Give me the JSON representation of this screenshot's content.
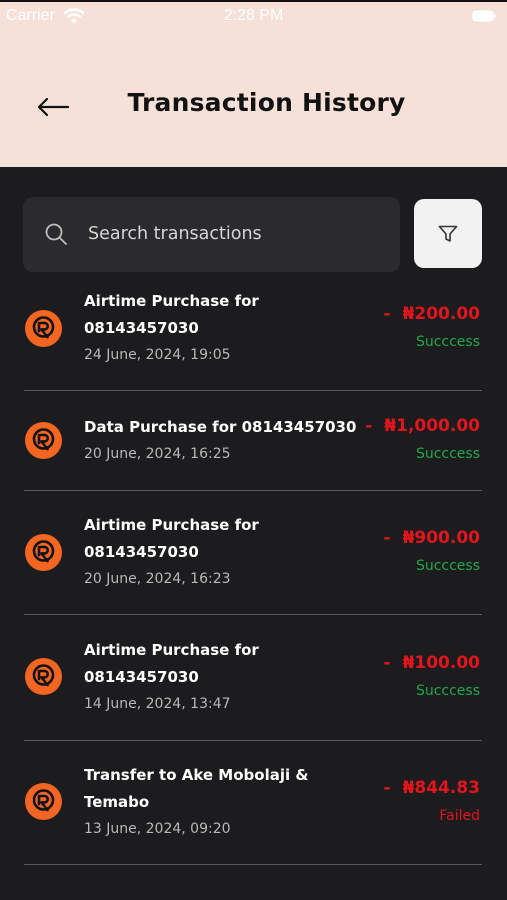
{
  "status_bar": {
    "carrier": "Carrier",
    "time": "2:28 PM",
    "wifi_icon": "wifi-icon",
    "battery_icon": "battery-icon"
  },
  "header": {
    "title": "Transaction History",
    "back_icon": "arrow-left-icon",
    "background": "#f6e1d8"
  },
  "search": {
    "placeholder": "Search transactions",
    "icon": "search-icon"
  },
  "filter": {
    "icon": "filter-icon"
  },
  "colors": {
    "background": "#1c1c1e",
    "amount": "#e2141c",
    "success": "#1fa94a",
    "failed": "#e2141c",
    "logo": "#f26522"
  },
  "transactions": [
    {
      "title": "Airtime Purchase for 08143457030",
      "date": "24 June, 2024, 19:05",
      "sign": "-",
      "amount": "₦200.00",
      "status": "Succcess"
    },
    {
      "title": "Data Purchase for 08143457030",
      "date": "20 June, 2024, 16:25",
      "sign": "-",
      "amount": "₦1,000.00",
      "status": "Succcess"
    },
    {
      "title": "Airtime Purchase for 08143457030",
      "date": "20 June, 2024, 16:23",
      "sign": "-",
      "amount": "₦900.00",
      "status": "Succcess"
    },
    {
      "title": "Airtime Purchase for 08143457030",
      "date": "14 June, 2024, 13:47",
      "sign": "-",
      "amount": "₦100.00",
      "status": "Succcess"
    },
    {
      "title": "Transfer to Ake Mobolaji & Temabo",
      "date": "13 June, 2024, 09:20",
      "sign": "-",
      "amount": "₦844.83",
      "status": "Failed"
    }
  ]
}
